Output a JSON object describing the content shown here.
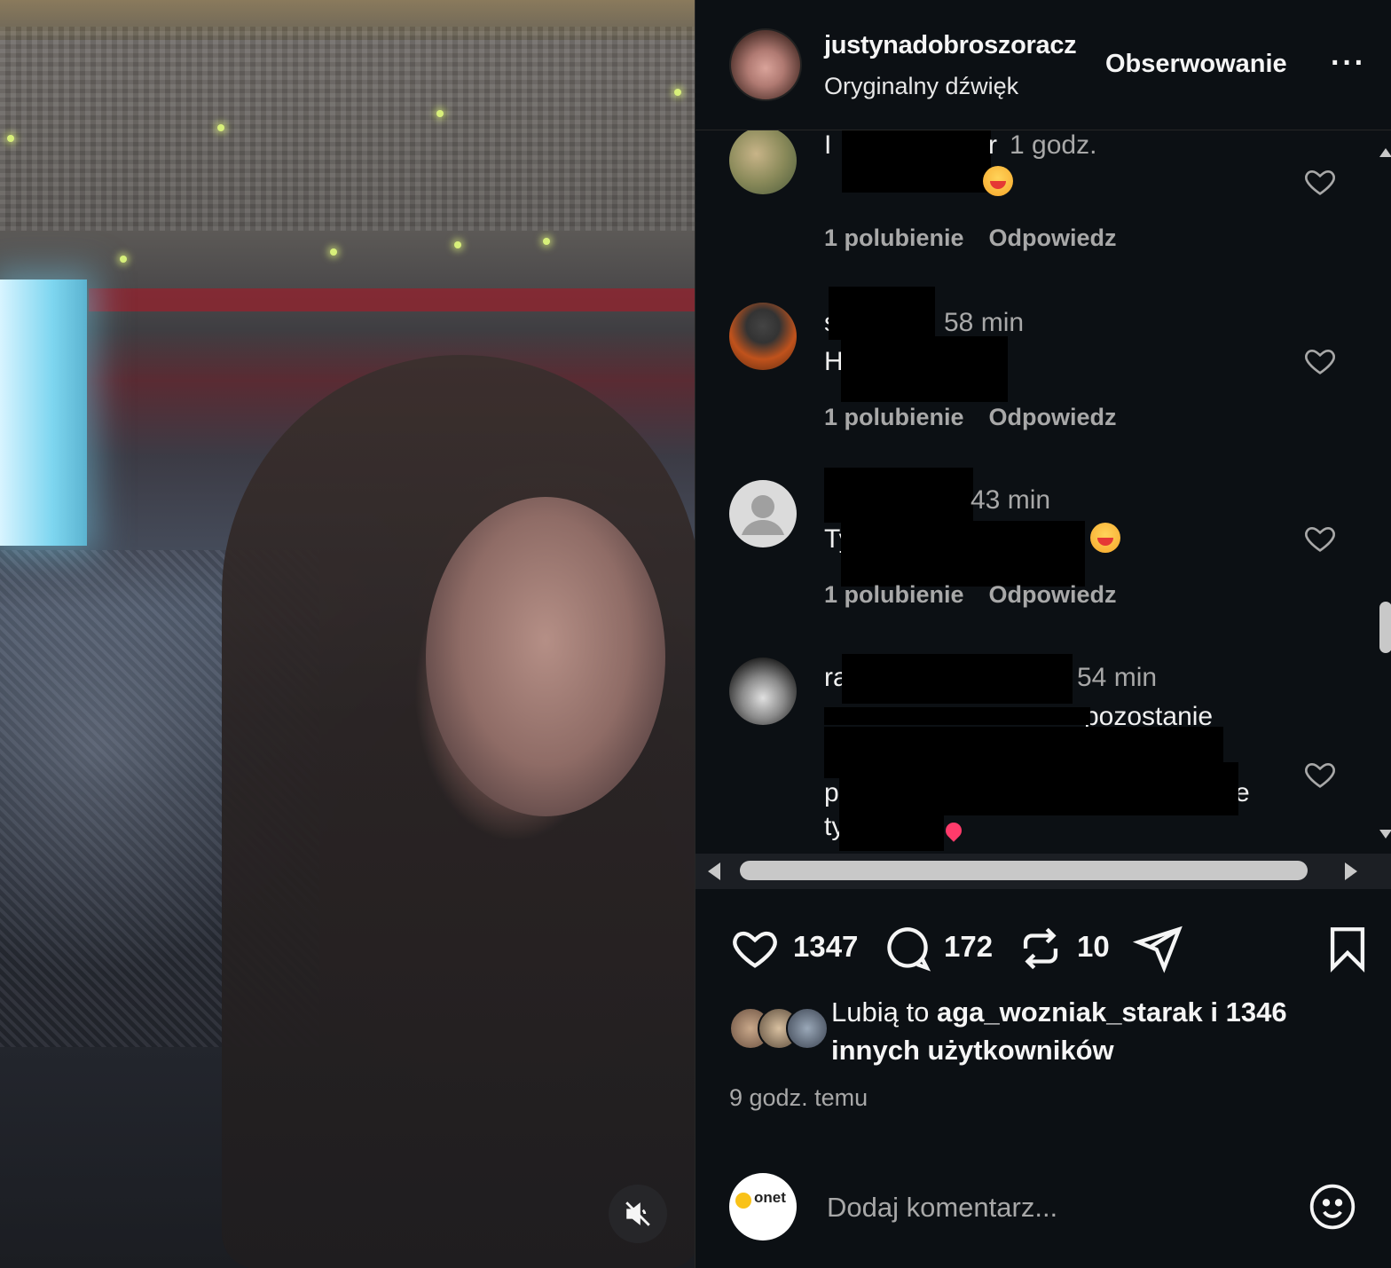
{
  "post": {
    "username": "justynadobroszoracz",
    "audio": "Oryginalny dźwięk",
    "follow_label": "Obserwowanie",
    "more_label": "···"
  },
  "comments": [
    {
      "time": "1 godz.",
      "user_visible": "r",
      "likes": "1 polubienie",
      "reply": "Odpowiedz",
      "emoji": "😂"
    },
    {
      "time": "58 min",
      "text_visible": "Ha",
      "likes": "1 polubienie",
      "reply": "Odpowiedz"
    },
    {
      "time": "43 min",
      "text_visible": "Ty",
      "likes": "1 polubienie",
      "reply": "Odpowiedz",
      "emoji": "😂"
    },
    {
      "time": "54 min",
      "user_visible": "ra",
      "text_visible": "pozostanie",
      "line3": "p",
      "line3_end": "e",
      "line4": "ty"
    }
  ],
  "actions": {
    "likes_count": "1347",
    "comments_count": "172",
    "reposts_count": "10"
  },
  "liked_by": {
    "prefix": "Lubią to",
    "user": "aga_wozniak_starak",
    "suffix": "i 1346 innych użytkowników"
  },
  "posted_time": "9 godz. temu",
  "add_comment": {
    "placeholder": "Dodaj komentarz...",
    "avatar_label": "onet"
  },
  "colors": {
    "panel_bg": "#0c1014",
    "text_primary": "#f5f5f5",
    "text_secondary": "#a8a8a8"
  },
  "icons": [
    "mute-icon",
    "heart-icon",
    "comment-icon",
    "repost-icon",
    "share-icon",
    "bookmark-icon",
    "emoji-icon",
    "more-icon"
  ]
}
